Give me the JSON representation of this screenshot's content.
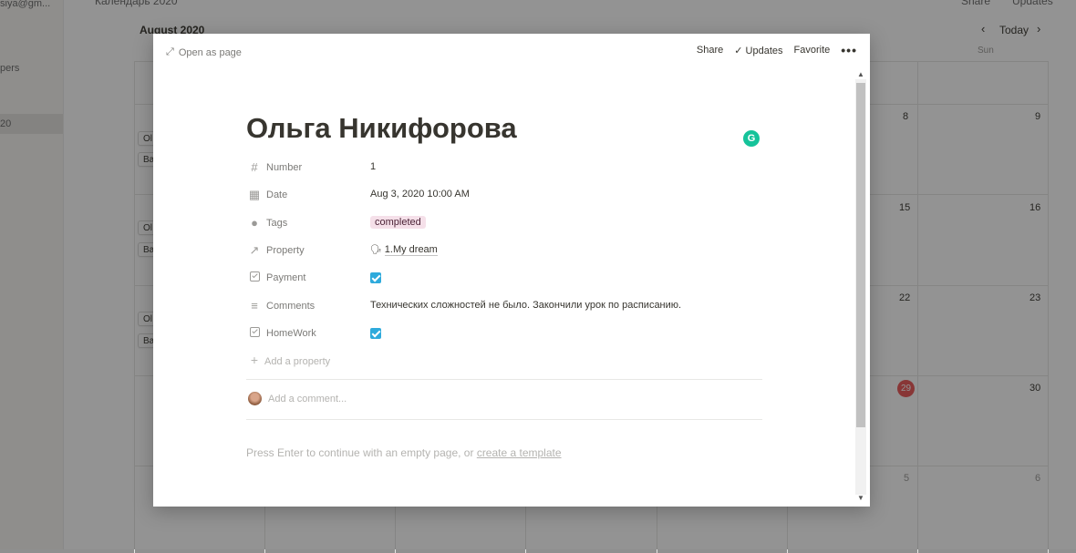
{
  "background": {
    "sidebar": {
      "email": "siya@gm...",
      "item_pers": "pers",
      "item_active": "20"
    },
    "topbar": {
      "breadcrumb": "Календарь 2020",
      "share": "Share",
      "updates": "Updates"
    },
    "calendar": {
      "month": "August 2020",
      "today_label": "Today",
      "sun_label": "Sun",
      "week_days": [
        [
          "8",
          "9"
        ],
        [
          "15",
          "16"
        ],
        [
          "22",
          "23"
        ],
        [
          "29",
          "30"
        ],
        [
          "5",
          "6"
        ]
      ],
      "chips": [
        "Ol",
        "Ba",
        "Ol",
        "Ba",
        "Ol",
        "Ba"
      ]
    }
  },
  "modal": {
    "open_as_page": "Open as page",
    "share": "Share",
    "updates": "Updates",
    "favorite": "Favorite",
    "more": "•••",
    "title": "Ольга Никифорова",
    "grammarly": "G",
    "properties": [
      {
        "icon": "number-icon",
        "glyph": "#",
        "name": "Number",
        "value": "1"
      },
      {
        "icon": "calendar-icon",
        "glyph": "▦",
        "name": "Date",
        "value": "Aug 3, 2020 10:00 AM"
      },
      {
        "icon": "tags-icon",
        "glyph": "●",
        "name": "Tags",
        "value": "completed"
      },
      {
        "icon": "relation-arrow-icon",
        "glyph": "↗",
        "name": "Property",
        "value": "1.My dream",
        "value_emoji": "🗣"
      },
      {
        "icon": "checkbox-icon",
        "name": "Payment",
        "checked": true
      },
      {
        "icon": "text-lines-icon",
        "glyph": "≡",
        "name": "Comments",
        "value": "Технических сложностей не было. Закончили урок по расписанию."
      },
      {
        "icon": "checkbox-icon",
        "name": "HomeWork",
        "checked": true
      }
    ],
    "add_property": "Add a property",
    "add_comment": "Add a comment...",
    "empty_hint_prefix": "Press Enter to continue with an empty page, or ",
    "empty_hint_link": "create a template"
  },
  "colors": {
    "tag_bg": "#f5e0e9",
    "checkbox": "#2eaadc",
    "today_badge": "#eb5757",
    "grammarly": "#15c39a"
  }
}
